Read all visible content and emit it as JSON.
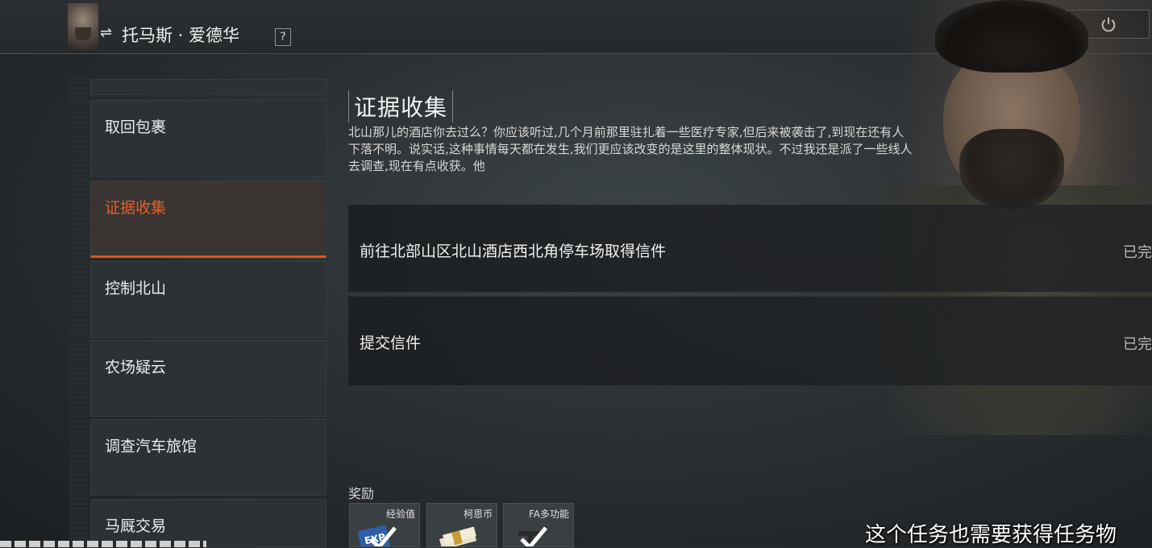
{
  "header": {
    "swap_icon": "⇌",
    "trader_name": "托马斯 · 爱德华",
    "help_label": "?"
  },
  "icons": {
    "power": "power-icon",
    "swap": "swap-arrows-icon",
    "checkmark": "checkmark-icon"
  },
  "colors": {
    "accent": "#e2602a",
    "active_underline": "#d9581e",
    "text": "#f0f0f0"
  },
  "task_list": [
    {
      "label": "取回包裹",
      "active": false
    },
    {
      "label": "证据收集",
      "active": true
    },
    {
      "label": "控制北山",
      "active": false
    },
    {
      "label": "农场疑云",
      "active": false
    },
    {
      "label": "调查汽车旅馆",
      "active": false
    },
    {
      "label": "马厩交易",
      "active": false
    }
  ],
  "task_detail": {
    "title": "证据收集",
    "description": "北山那儿的酒店你去过么？你应该听过,几个月前那里驻扎着一些医疗专家,但后来被袭击了,到现在还有人下落不明。说实话,这种事情每天都在发生,我们更应该改变的是这里的整体现状。不过我还是派了一些线人去调查,现在有点收获。他"
  },
  "objectives": [
    {
      "text": "前往北部山区北山酒店西北角停车场取得信件",
      "status": "已完"
    },
    {
      "text": "提交信件",
      "status": "已完"
    }
  ],
  "rewards": {
    "label": "奖励",
    "items": [
      {
        "name": "经验值",
        "icon": "exp-card-icon",
        "claimed": true
      },
      {
        "name": "柯恩币",
        "icon": "money-stack-icon",
        "claimed": false
      },
      {
        "name": "FA多功能",
        "icon": "weapon-icon",
        "claimed": true
      }
    ]
  },
  "subtitle": "这个任务也需要获得任务物"
}
